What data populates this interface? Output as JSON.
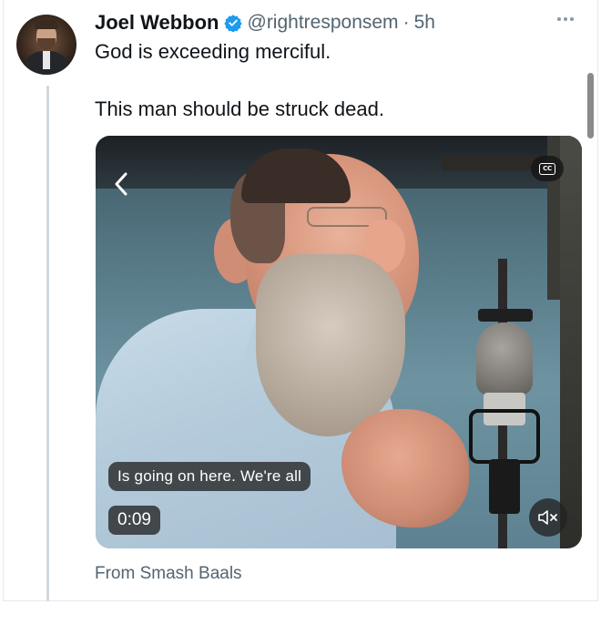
{
  "tweet": {
    "author_name": "Joel Webbon",
    "handle": "@rightresponsem",
    "separator": "·",
    "time": "5h",
    "text_line_1": "God is exceeding merciful.",
    "text_line_2": "This man should be struck dead.",
    "verified": true
  },
  "video": {
    "caption": "Is going on here. We're all",
    "duration": "0:09",
    "cc_label": "CC",
    "source": "From Smash Baals"
  },
  "icons": {
    "verified": "verified-badge-icon",
    "more": "more-options-icon",
    "back": "chevron-left-icon",
    "cc": "closed-captions-icon",
    "mute": "volume-muted-icon"
  },
  "colors": {
    "text_primary": "#0f1419",
    "text_secondary": "#536471",
    "verified_blue": "#1d9bf0",
    "thread_line": "#cfd9de"
  }
}
